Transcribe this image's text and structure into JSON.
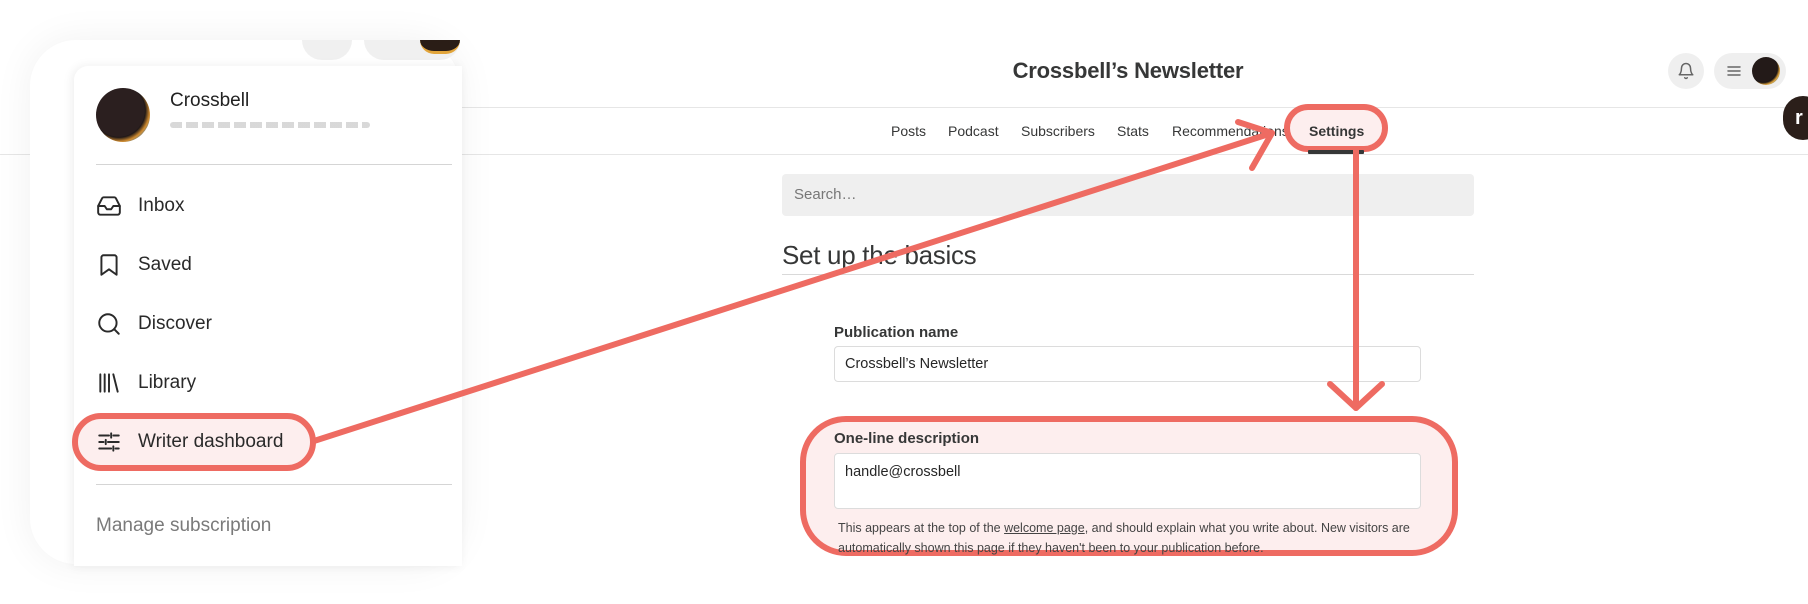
{
  "header": {
    "title": "Crossbell’s Newsletter",
    "notifications_icon": "bell-icon",
    "menu_icon": "hamburger-icon"
  },
  "nav": {
    "items": [
      "Posts",
      "Podcast",
      "Subscribers",
      "Stats",
      "Recommendations",
      "Settings"
    ],
    "active": "Settings"
  },
  "search": {
    "placeholder": "Search…"
  },
  "section": {
    "title": "Set up the basics"
  },
  "form": {
    "publication_name_label": "Publication name",
    "publication_name_value": "Crossbell’s Newsletter",
    "description_label": "One-line description",
    "description_value": "handle@crossbell",
    "helper_prefix": "This appears at the top of the ",
    "helper_link": "welcome page",
    "helper_suffix": ", and should explain what you write about. New visitors are automatically shown this page if they haven't been to your publication before."
  },
  "side_badge": {
    "letter": "r"
  },
  "menu_panel": {
    "user_name": "Crossbell",
    "items": [
      {
        "label": "Inbox",
        "icon": "inbox-icon"
      },
      {
        "label": "Saved",
        "icon": "bookmark-icon"
      },
      {
        "label": "Discover",
        "icon": "search-icon"
      },
      {
        "label": "Library",
        "icon": "library-icon"
      },
      {
        "label": "Writer dashboard",
        "icon": "sliders-icon"
      }
    ],
    "manage_subscription": "Manage subscription"
  },
  "colors": {
    "annotation": "#ee6b62",
    "annotation_fill": "#fdeeee",
    "text": "#363737",
    "field_bg": "#efefef"
  }
}
